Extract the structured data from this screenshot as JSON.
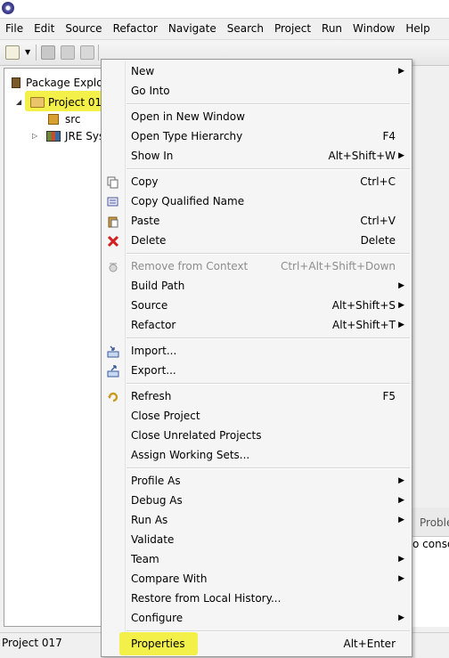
{
  "menubar": [
    "File",
    "Edit",
    "Source",
    "Refactor",
    "Navigate",
    "Search",
    "Project",
    "Run",
    "Window",
    "Help"
  ],
  "package_explorer": {
    "title": "Package Explor",
    "project": "Project 017",
    "children": [
      "src",
      "JRE Syst"
    ]
  },
  "right_panel": {
    "tab": "Proble",
    "text": "o conso"
  },
  "status": "Project 017",
  "context_menu": {
    "groups": [
      [
        {
          "label": "New",
          "shortcut": "",
          "submenu": true,
          "icon": ""
        },
        {
          "label": "Go Into",
          "shortcut": "",
          "submenu": false,
          "icon": ""
        }
      ],
      [
        {
          "label": "Open in New Window",
          "shortcut": "",
          "submenu": false,
          "icon": ""
        },
        {
          "label": "Open Type Hierarchy",
          "shortcut": "F4",
          "submenu": false,
          "icon": ""
        },
        {
          "label": "Show In",
          "shortcut": "Alt+Shift+W",
          "submenu": true,
          "icon": ""
        }
      ],
      [
        {
          "label": "Copy",
          "shortcut": "Ctrl+C",
          "submenu": false,
          "icon": "copy-icon"
        },
        {
          "label": "Copy Qualified Name",
          "shortcut": "",
          "submenu": false,
          "icon": "copy-qualified-name-icon"
        },
        {
          "label": "Paste",
          "shortcut": "Ctrl+V",
          "submenu": false,
          "icon": "paste-icon"
        },
        {
          "label": "Delete",
          "shortcut": "Delete",
          "submenu": false,
          "icon": "delete-icon"
        }
      ],
      [
        {
          "label": "Remove from Context",
          "shortcut": "Ctrl+Alt+Shift+Down",
          "submenu": false,
          "icon": "remove-from-context-icon",
          "disabled": true
        },
        {
          "label": "Build Path",
          "shortcut": "",
          "submenu": true,
          "icon": ""
        },
        {
          "label": "Source",
          "shortcut": "Alt+Shift+S",
          "submenu": true,
          "icon": ""
        },
        {
          "label": "Refactor",
          "shortcut": "Alt+Shift+T",
          "submenu": true,
          "icon": ""
        }
      ],
      [
        {
          "label": "Import...",
          "shortcut": "",
          "submenu": false,
          "icon": "import-icon"
        },
        {
          "label": "Export...",
          "shortcut": "",
          "submenu": false,
          "icon": "export-icon"
        }
      ],
      [
        {
          "label": "Refresh",
          "shortcut": "F5",
          "submenu": false,
          "icon": "refresh-icon"
        },
        {
          "label": "Close Project",
          "shortcut": "",
          "submenu": false,
          "icon": ""
        },
        {
          "label": "Close Unrelated Projects",
          "shortcut": "",
          "submenu": false,
          "icon": ""
        },
        {
          "label": "Assign Working Sets...",
          "shortcut": "",
          "submenu": false,
          "icon": ""
        }
      ],
      [
        {
          "label": "Profile As",
          "shortcut": "",
          "submenu": true,
          "icon": ""
        },
        {
          "label": "Debug As",
          "shortcut": "",
          "submenu": true,
          "icon": ""
        },
        {
          "label": "Run As",
          "shortcut": "",
          "submenu": true,
          "icon": ""
        },
        {
          "label": "Validate",
          "shortcut": "",
          "submenu": false,
          "icon": ""
        },
        {
          "label": "Team",
          "shortcut": "",
          "submenu": true,
          "icon": ""
        },
        {
          "label": "Compare With",
          "shortcut": "",
          "submenu": true,
          "icon": ""
        },
        {
          "label": "Restore from Local History...",
          "shortcut": "",
          "submenu": false,
          "icon": ""
        },
        {
          "label": "Configure",
          "shortcut": "",
          "submenu": true,
          "icon": ""
        }
      ],
      [
        {
          "label": "Properties",
          "shortcut": "Alt+Enter",
          "submenu": false,
          "icon": ""
        }
      ]
    ]
  },
  "colors": {
    "highlight": "#f4f04a",
    "menu_bg": "#f5f5f5",
    "disabled_text": "#8d8d8d"
  }
}
